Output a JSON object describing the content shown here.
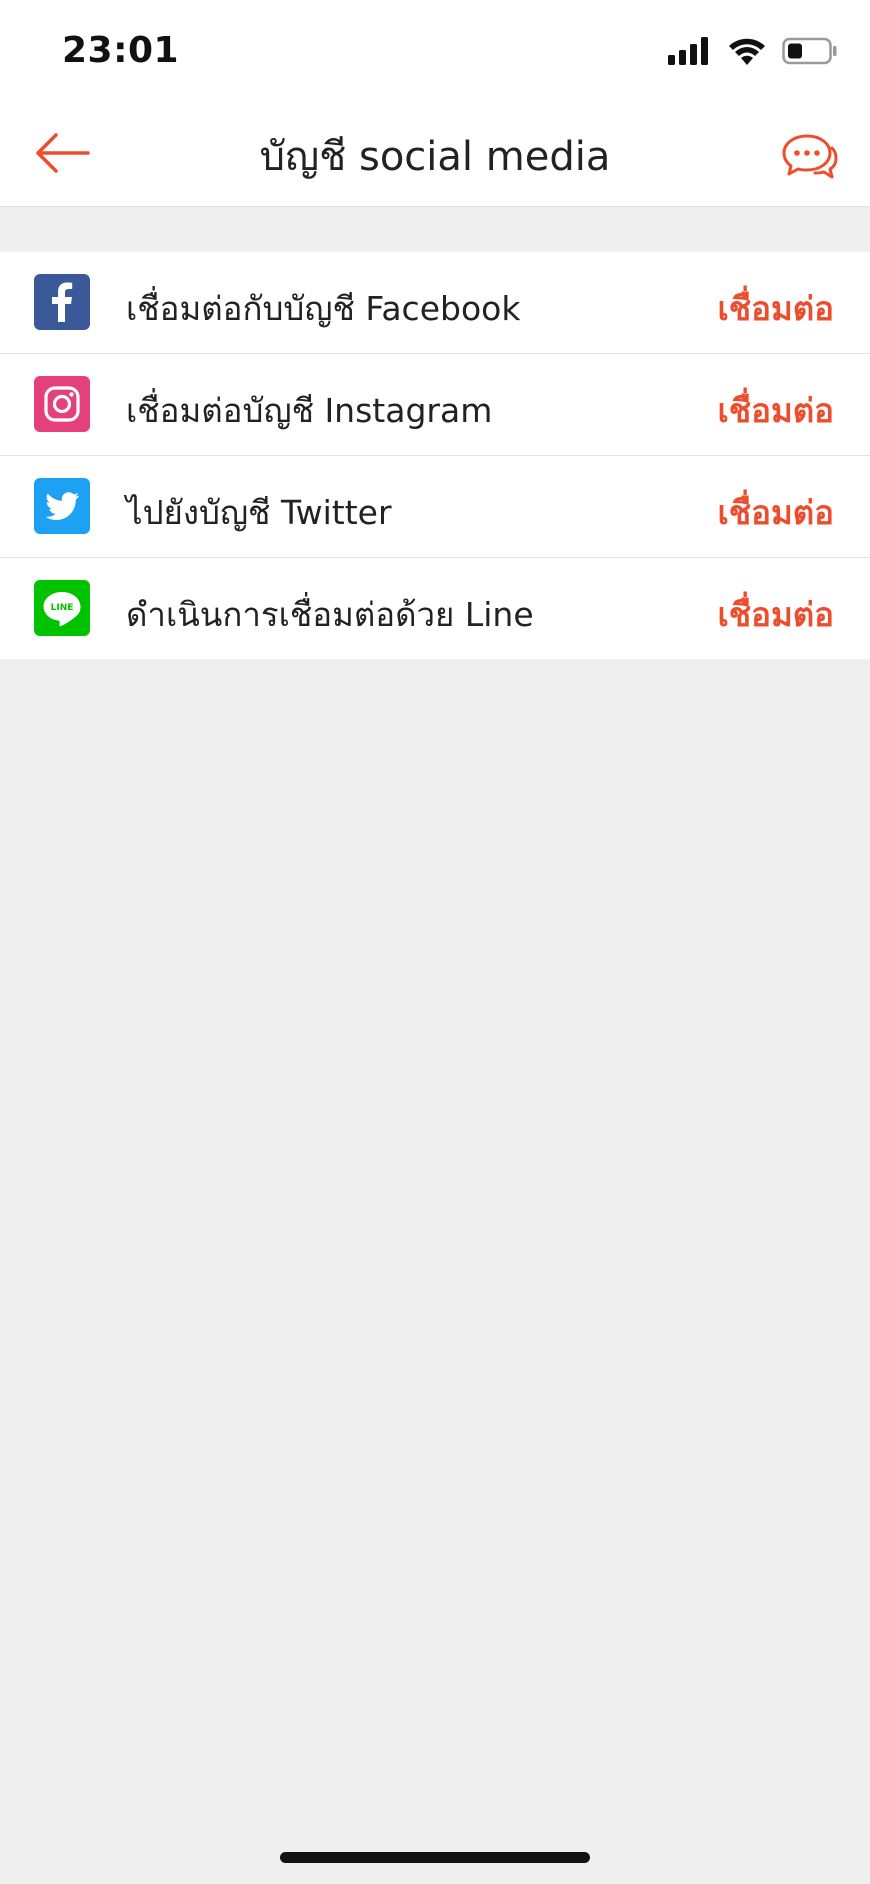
{
  "status_bar": {
    "time": "23:01",
    "icons": [
      "cellular-signal-icon",
      "wifi-icon",
      "battery-icon"
    ]
  },
  "header": {
    "title": "บัญชี social media",
    "back_icon": "arrow-left-icon",
    "chat_icon": "chat-bubbles-icon"
  },
  "accounts": [
    {
      "icon": "facebook-icon",
      "color": "#3b5998",
      "label": "เชื่อมต่อกับบัญชี Facebook",
      "action": "เชื่อมต่อ"
    },
    {
      "icon": "instagram-icon",
      "color": "#e4407b",
      "label": "เชื่อมต่อบัญชี Instagram",
      "action": "เชื่อมต่อ"
    },
    {
      "icon": "twitter-icon",
      "color": "#1da1f2",
      "label": "ไปยังบัญชี Twitter",
      "action": "เชื่อมต่อ"
    },
    {
      "icon": "line-icon",
      "color": "#00c300",
      "label": "ดำเนินการเชื่อมต่อด้วย Line",
      "action": "เชื่อมต่อ",
      "icon_text": "LINE"
    }
  ],
  "colors": {
    "accent": "#ee4d2d",
    "background": "#efefef",
    "surface": "#ffffff"
  }
}
